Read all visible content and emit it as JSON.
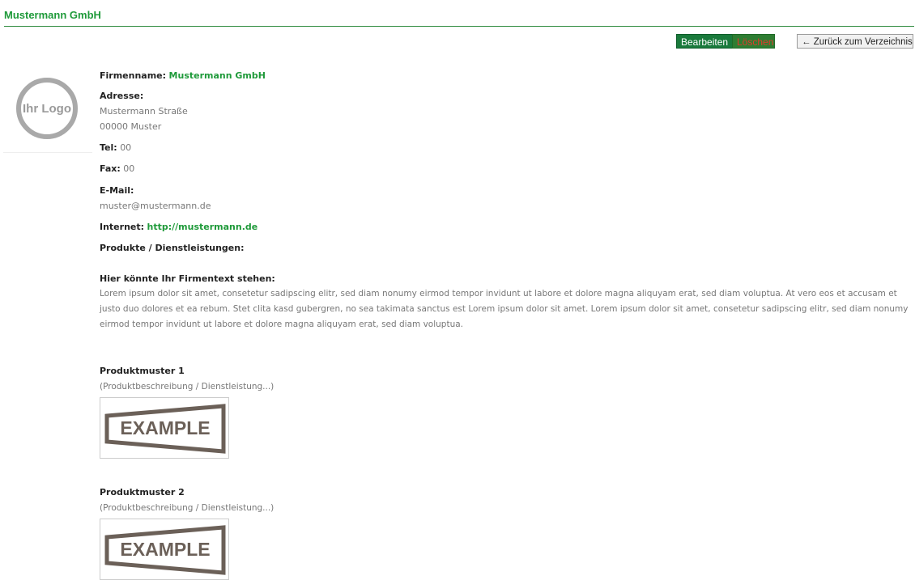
{
  "header": {
    "title": "Mustermann GmbH"
  },
  "toolbar": {
    "edit_label": "Bearbeiten",
    "delete_label": "Löschen",
    "back_label": "← Zurück zum Verzeichnis"
  },
  "logo": {
    "text": "Ihr Logo"
  },
  "company": {
    "name_label": "Firmenname:",
    "name_value": "Mustermann GmbH",
    "address_label": "Adresse:",
    "address_line1": "Mustermann Straße",
    "address_line2": "00000 Muster",
    "tel_label": "Tel:",
    "tel_value": "00",
    "fax_label": "Fax:",
    "fax_value": "00",
    "email_label": "E-Mail:",
    "email_value": "muster@mustermann.de",
    "internet_label": "Internet:",
    "internet_value": "http://mustermann.de",
    "products_label": "Produkte / Dienstleistungen:"
  },
  "description": {
    "heading": "Hier könnte Ihr Firmentext stehen:",
    "text": "Lorem ipsum dolor sit amet, consetetur sadipscing elitr, sed diam nonumy eirmod tempor invidunt ut labore et dolore magna aliquyam erat, sed diam voluptua. At vero eos et accusam et justo duo dolores et ea rebum. Stet clita kasd gubergren, no sea takimata sanctus est Lorem ipsum dolor sit amet. Lorem ipsum dolor sit amet, consetetur sadipscing elitr, sed diam nonumy eirmod tempor invidunt ut labore et dolore magna aliquyam erat, sed diam voluptua."
  },
  "products": [
    {
      "title": "Produktmuster 1",
      "desc": "(Produktbeschreibung / Dienstleistung...)",
      "image_text": "EXAMPLE"
    },
    {
      "title": "Produktmuster 2",
      "desc": "(Produktbeschreibung / Dienstleistung...)",
      "image_text": "EXAMPLE"
    }
  ],
  "colors": {
    "brand_green": "#1f9a3a",
    "button_green": "#1a7a3c",
    "delete_text_red": "#e23a2c"
  }
}
